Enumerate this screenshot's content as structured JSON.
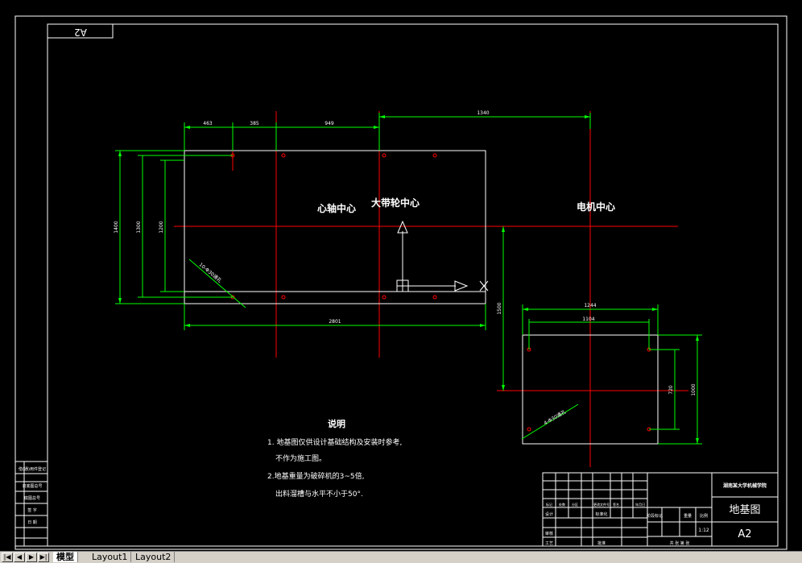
{
  "drawing": {
    "sheet_tag": "A2",
    "labels": {
      "spindle_center": "心轴中心",
      "pulley_center": "大带轮中心",
      "motor_center": "电机中心"
    },
    "dimensions": {
      "d463": "463",
      "d385": "385",
      "d949": "949",
      "d1340": "1340",
      "d1400": "1400",
      "d1300": "1300",
      "d1200": "1200",
      "d2801": "2801",
      "d1500": "1500",
      "d1244": "1244",
      "d1104": "1104",
      "d720": "720",
      "d1000": "1000",
      "hole_note_1": "10-Φ30通孔",
      "hole_note_2": "4-Φ30通孔"
    },
    "notes": {
      "title": "说明",
      "line1": "1. 地基图仅供设计基础结构及安装时参考,",
      "line2": "不作为施工图。",
      "line3": "2.地基重量为破碎机的3~5倍,",
      "line4": "出料溜槽与水平不小于50°."
    },
    "title_block": {
      "company": "湖南某大学机械学院",
      "drawing_name": "地基图",
      "scale": "1:12",
      "sheet_size": "A2",
      "col_labels": [
        "标记",
        "处数",
        "分区",
        "更改文件号",
        "签名",
        "年月日"
      ],
      "designer": "设计",
      "standardization": "标准化",
      "review": "审核",
      "process": "工艺",
      "approve": "批准",
      "stage_mark": "阶段标记",
      "weight": "重量",
      "ratio": "比例",
      "sheets": "共 张 第 张"
    },
    "left_strip": [
      "借(通)用件登记",
      "旧底图总号",
      "底图总号",
      "签 字",
      "日 期"
    ]
  },
  "tabs": {
    "model": "模型",
    "layout1": "Layout1",
    "layout2": "Layout2"
  },
  "colors": {
    "background": "#000000",
    "lines": "#ffffff",
    "dimensions": "#00ff00",
    "centerlines": "#ff0000",
    "holes": "#ff0000"
  }
}
